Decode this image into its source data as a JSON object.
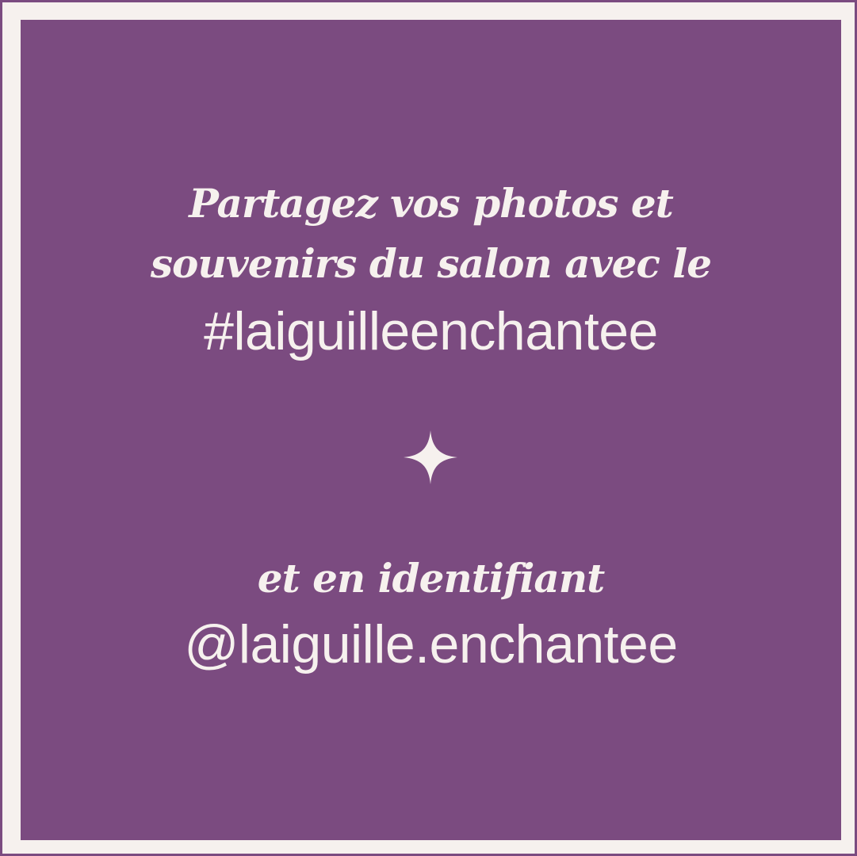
{
  "text": {
    "line1": "Partagez vos photos et",
    "line2": "souvenirs du salon avec le",
    "hashtag": "#laiguilleenchantee",
    "line3": "et en identifiant",
    "handle": "@laiguille.enchantee"
  },
  "decoration": {
    "divider_icon": "sparkle-icon"
  },
  "colors": {
    "background": "#7b4b80",
    "frame": "#f6f1ee",
    "text": "#f6f1ee"
  }
}
